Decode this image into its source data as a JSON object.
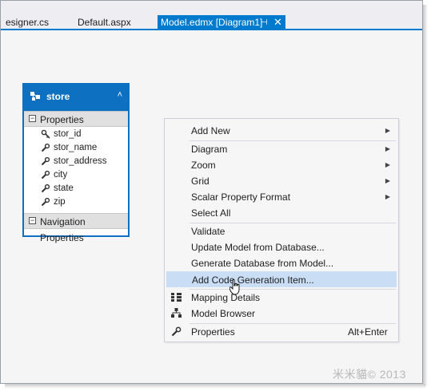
{
  "tabs": [
    {
      "label": "esigner.cs"
    },
    {
      "label": "Default.aspx"
    },
    {
      "label": "Model.edmx [Diagram1]",
      "pin": "⊣",
      "close": "✕"
    }
  ],
  "entity": {
    "name": "store",
    "properties_label": "Properties",
    "properties": [
      "stor_id",
      "stor_name",
      "stor_address",
      "city",
      "state",
      "zip"
    ],
    "navigation_label": "Navigation Properties"
  },
  "menu": {
    "items": [
      {
        "label": "Add New",
        "submenu": true
      },
      {
        "label": "Diagram",
        "submenu": true
      },
      {
        "label": "Zoom",
        "submenu": true
      },
      {
        "label": "Grid",
        "submenu": true
      },
      {
        "label": "Scalar Property Format",
        "submenu": true
      },
      {
        "label": "Select All"
      },
      {
        "label": "Validate"
      },
      {
        "label": "Update Model from Database..."
      },
      {
        "label": "Generate Database from Model..."
      },
      {
        "label": "Add Code Generation Item...",
        "highlighted": true
      },
      {
        "label": "Mapping Details",
        "icon": "mapping-details-icon"
      },
      {
        "label": "Model Browser",
        "icon": "model-browser-icon"
      },
      {
        "label": "Properties",
        "icon": "wrench-icon",
        "shortcut": "Alt+Enter"
      }
    ]
  },
  "watermark": "米米貓© 2013",
  "colors": {
    "accent": "#007acc",
    "entity": "#0e70c0",
    "highlight": "#c9def5"
  }
}
